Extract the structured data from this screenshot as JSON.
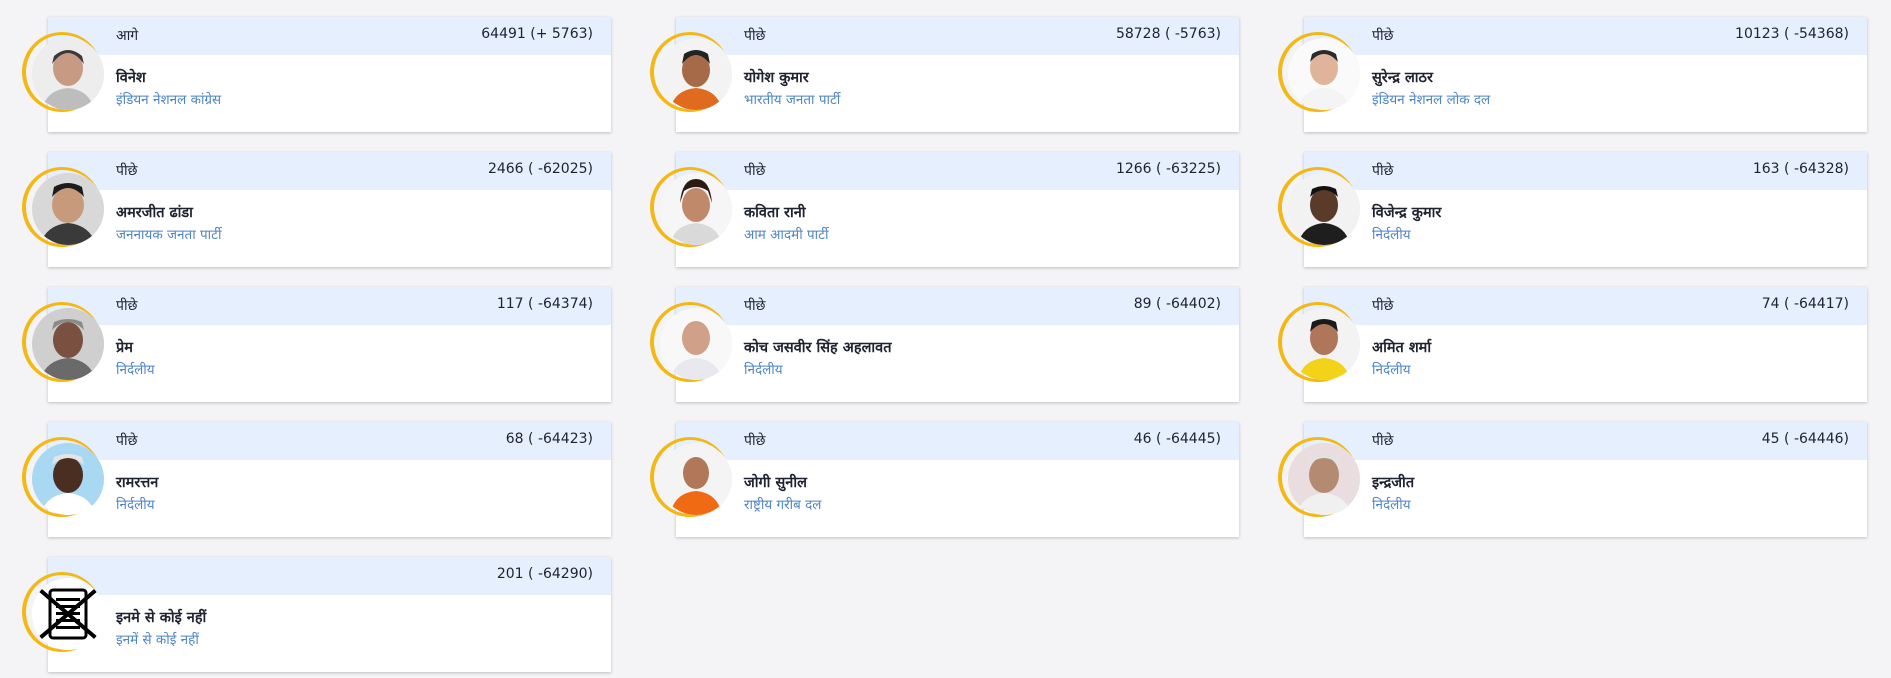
{
  "colors": {
    "header_bg": "#e5effd",
    "party_text": "#4f85c8",
    "ring": "#f4b816",
    "card_bg": "#ffffff",
    "page_bg": "#f4f4f6"
  },
  "candidates": [
    {
      "status": "आगे",
      "votes": "64491 (+ 5763)",
      "name": "विनेश",
      "party": "इंडियन नेशनल कांग्रेस"
    },
    {
      "status": "पीछे",
      "votes": "58728 ( -5763)",
      "name": "योगेश कुमार",
      "party": "भारतीय जनता पार्टी"
    },
    {
      "status": "पीछे",
      "votes": "10123 ( -54368)",
      "name": "सुरेन्द्र लाठर",
      "party": "इंडियन नेशनल लोक दल"
    },
    {
      "status": "पीछे",
      "votes": "2466 ( -62025)",
      "name": "अमरजीत ढांडा",
      "party": "जननायक जनता पार्टी"
    },
    {
      "status": "पीछे",
      "votes": "1266 ( -63225)",
      "name": "कविता रानी",
      "party": "आम आदमी पार्टी"
    },
    {
      "status": "पीछे",
      "votes": "163 ( -64328)",
      "name": "विजेन्द्र कुमार",
      "party": "निर्दलीय"
    },
    {
      "status": "पीछे",
      "votes": "117 ( -64374)",
      "name": "प्रेम",
      "party": "निर्दलीय"
    },
    {
      "status": "पीछे",
      "votes": "89 ( -64402)",
      "name": "कोच जसवीर सिंह अहलावत",
      "party": "निर्दलीय"
    },
    {
      "status": "पीछे",
      "votes": "74 ( -64417)",
      "name": "अमित शर्मा",
      "party": "निर्दलीय"
    },
    {
      "status": "पीछे",
      "votes": "68 ( -64423)",
      "name": "रामरत्तन",
      "party": "निर्दलीय"
    },
    {
      "status": "पीछे",
      "votes": "46 ( -64445)",
      "name": "जोगी सुनील",
      "party": "राष्ट्रीय गरीब दल"
    },
    {
      "status": "पीछे",
      "votes": "45 ( -64446)",
      "name": "इन्द्रजीत",
      "party": "निर्दलीय"
    },
    {
      "status": "",
      "votes": "201 ( -64290)",
      "name": "इनमे से कोई नहीं",
      "party": "इनमें से कोई नहीं"
    }
  ]
}
